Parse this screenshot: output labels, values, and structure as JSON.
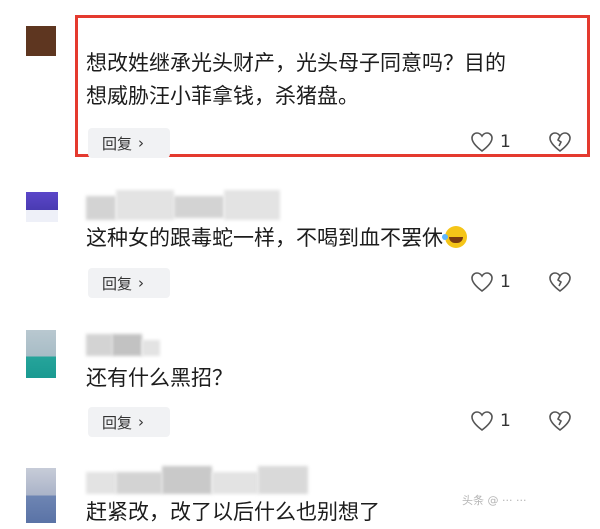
{
  "comments": [
    {
      "text_lines": [
        "想改姓继承光头财产，光头母子同意吗？目的",
        "想威胁汪小菲拿钱，杀猪盘。"
      ],
      "reply_label": "回复",
      "like_count": "1",
      "highlighted": true
    },
    {
      "text": "这种女的跟毒蛇一样，不喝到血不罢休",
      "reply_label": "回复",
      "like_count": "1"
    },
    {
      "text": "还有什么黑招？",
      "reply_label": "回复",
      "like_count": "1"
    },
    {
      "text": "赶紧改，改了以后什么也别想了"
    }
  ],
  "icons": {
    "reply_chevron": "chevron-right-icon",
    "like": "heart-icon",
    "dislike": "broken-heart-icon",
    "reaction_emoji": "laughing-crying-emoji-icon"
  },
  "colors": {
    "highlight_border": "#e43a2f",
    "reply_button_bg": "#f1f2f4",
    "text": "#1c1c1c"
  }
}
